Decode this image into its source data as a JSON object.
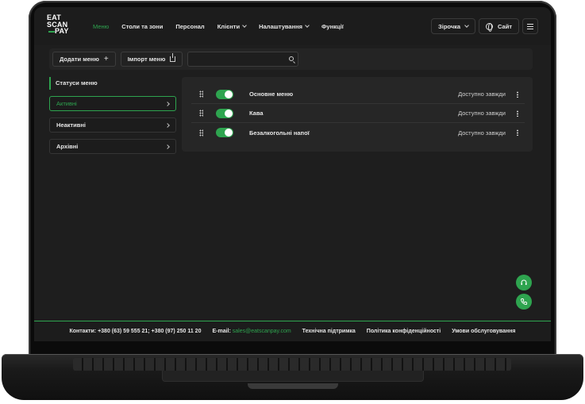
{
  "logo": {
    "line1": "EAT",
    "line2": "SCAN",
    "line3": "PAY"
  },
  "nav": [
    {
      "label": "Меню",
      "active": true,
      "dropdown": false
    },
    {
      "label": "Столи та зони",
      "active": false,
      "dropdown": false
    },
    {
      "label": "Персонал",
      "active": false,
      "dropdown": false
    },
    {
      "label": "Клієнти",
      "active": false,
      "dropdown": true
    },
    {
      "label": "Налаштування",
      "active": false,
      "dropdown": true
    },
    {
      "label": "Функції",
      "active": false,
      "dropdown": false
    }
  ],
  "header_right": {
    "venue": "Зірочка",
    "site": "Сайт"
  },
  "toolbar": {
    "add_menu": "Додати меню",
    "import_menu": "Імпорт меню",
    "search_placeholder": ""
  },
  "statuses": {
    "title": "Статуси меню",
    "items": [
      "Активні",
      "Неактивні",
      "Архівні"
    ],
    "active_index": 0
  },
  "menus": [
    {
      "name": "Основне меню",
      "availability": "Доступно завжди",
      "enabled": true
    },
    {
      "name": "Кава",
      "availability": "Доступно завжди",
      "enabled": true
    },
    {
      "name": "Безалкогольні напої",
      "availability": "Доступно завжди",
      "enabled": true
    }
  ],
  "footer": {
    "contacts": "Контакти: +380 (63) 59 555 21; +380 (97) 250 11 20",
    "email_label": "E-mail:",
    "email": "sales@eatscanpay.com",
    "support": "Технічна підтримка",
    "privacy": "Політика конфіденційності",
    "terms": "Умови обслуговування"
  },
  "colors": {
    "accent": "#2ea44f",
    "background": "#1e1e1e",
    "panel": "#262626"
  },
  "icons": [
    "plus-icon",
    "upload-icon",
    "search-icon",
    "globe-icon",
    "menu-icon",
    "chevron-right-icon",
    "drag-handle-icon",
    "kebab-icon",
    "headset-icon",
    "phone-icon"
  ]
}
